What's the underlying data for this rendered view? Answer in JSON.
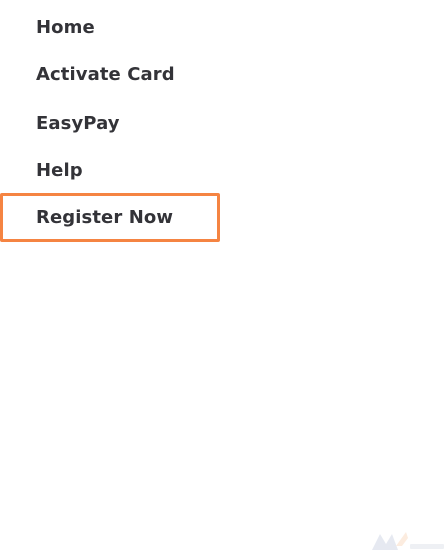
{
  "menu": {
    "items": [
      {
        "label": "Home"
      },
      {
        "label": "Activate Card"
      },
      {
        "label": "EasyPay"
      },
      {
        "label": "Help"
      },
      {
        "label": "Register Now"
      }
    ]
  },
  "highlight": {
    "target": "Register Now",
    "color": "#f58442"
  },
  "watermark": {
    "icon": "brand-logo-icon"
  }
}
